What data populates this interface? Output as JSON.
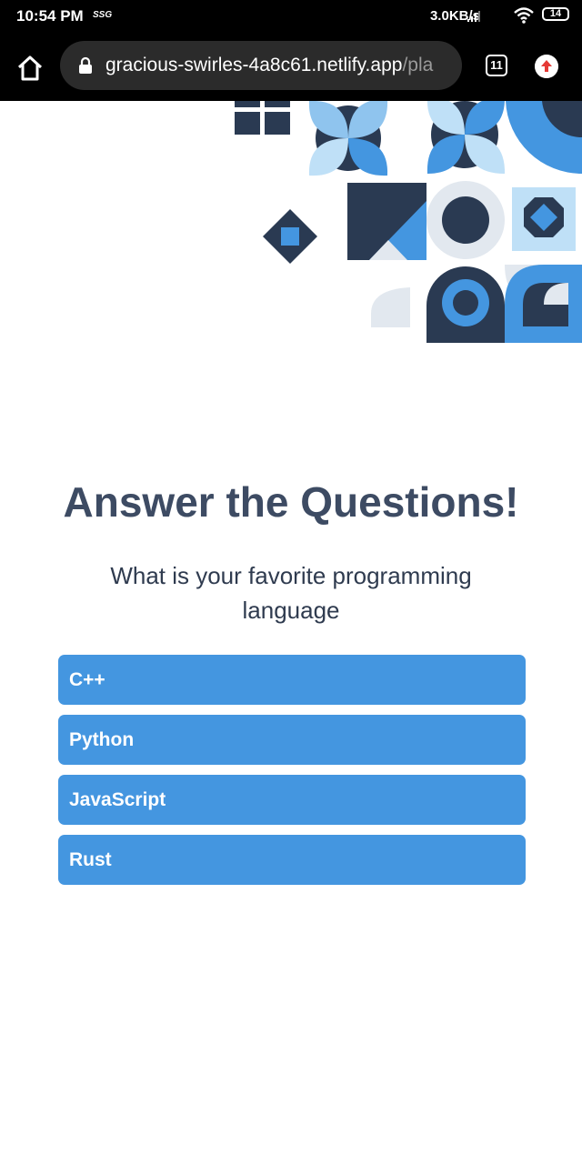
{
  "status_bar": {
    "time": "10:54 PM",
    "extra": "SSG",
    "speed": "3.0KB/s",
    "battery": "14",
    "icons": [
      "signal-icon",
      "wifi-icon",
      "battery-icon"
    ]
  },
  "browser": {
    "url_main": "gracious-swirles-4a8c61.netlify.app",
    "url_dim": "/pla",
    "tab_count": "11",
    "icons": [
      "home-icon",
      "lock-icon",
      "tabs-icon",
      "update-icon"
    ]
  },
  "colors": {
    "accent": "#4496e0",
    "dark_navy": "#2a3a52",
    "light_blue": "#bfe0f7",
    "title_text": "#3d4b63"
  },
  "quiz": {
    "title": "Answer the Questions!",
    "question": "What is your favorite programming language",
    "answers": [
      "C++",
      "Python",
      "JavaScript",
      "Rust"
    ]
  }
}
